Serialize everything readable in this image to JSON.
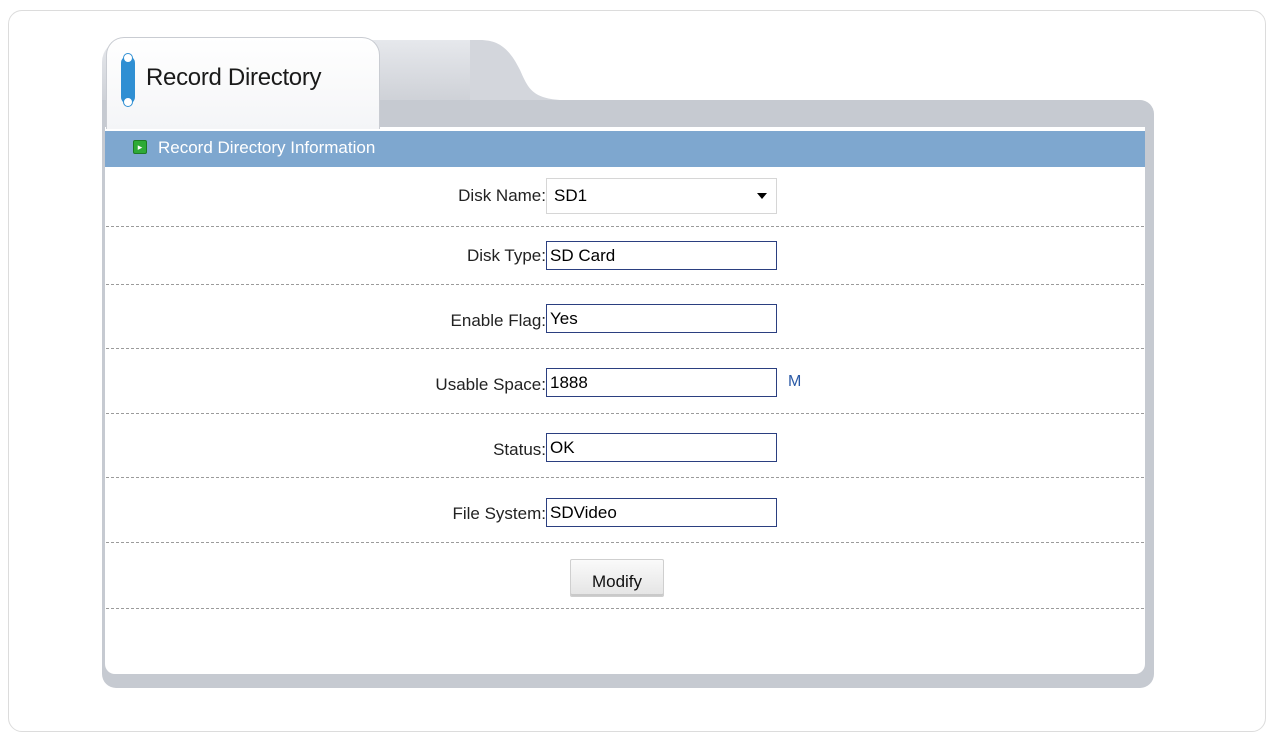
{
  "tab": {
    "title": "Record Directory"
  },
  "section": {
    "title": "Record Directory Information"
  },
  "form": {
    "disk_name": {
      "label": "Disk Name:",
      "value": "SD1"
    },
    "disk_type": {
      "label": "Disk Type:",
      "value": "SD Card"
    },
    "enable_flag": {
      "label": "Enable Flag:",
      "value": "Yes"
    },
    "usable_space": {
      "label": "Usable Space:",
      "value": "1888",
      "unit": "M"
    },
    "status": {
      "label": "Status:",
      "value": "OK"
    },
    "file_system": {
      "label": "File System:",
      "value": "SDVideo"
    }
  },
  "actions": {
    "modify_label": "Modify"
  },
  "colors": {
    "section_bar": "#7ea7cf",
    "tab_accent": "#2f8fd3",
    "field_border": "#2b3f80",
    "unit_text": "#2b5aa6"
  },
  "icons": {
    "tab": "tab-marker-icon",
    "section": "arrow-right-icon",
    "dropdown": "chevron-down-icon"
  }
}
